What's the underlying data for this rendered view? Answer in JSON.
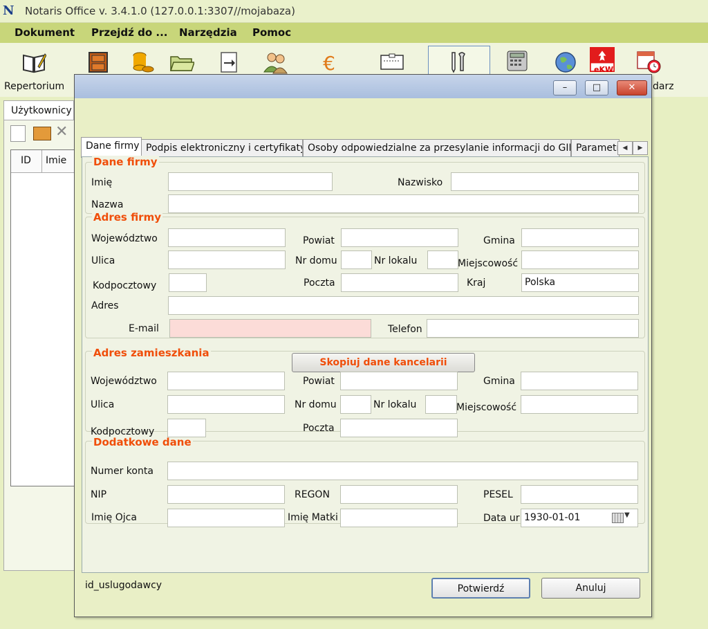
{
  "window": {
    "title": "Notaris Office v. 3.4.1.0 (127.0.0.1:3307//mojabaza)",
    "logo_letter": "N"
  },
  "menu": [
    "Dokument",
    "Przejdź do ...",
    "Narzędzia",
    "Pomoc"
  ],
  "toolbar": {
    "labels": {
      "first": "Repertorium",
      "last": "darz"
    },
    "icons": [
      "book-pen-icon",
      "drawer-icon",
      "coins-icon",
      "folder-icon",
      "document-arrow-icon",
      "people-icon",
      "euro-icon",
      "scanner-icon",
      "tools-icon",
      "calculator-icon",
      "globe-icon",
      "ekw-eagle-icon",
      "calendar-clock-icon"
    ],
    "ekw_text": "eKW",
    "euro_symbol": "€"
  },
  "background": {
    "tab": "Użytkownicy",
    "columns": [
      "ID",
      "Imie"
    ]
  },
  "dialog": {
    "window_buttons": {
      "minimize": "–",
      "maximize": "□",
      "close": "✕"
    },
    "tabs": [
      "Dane firmy",
      "Podpis elektroniczny i certyfikaty",
      "Osoby odpowiedzialne za przesylanie informacji do GIIF",
      "Parametr"
    ],
    "tab_arrows": [
      "◀",
      "▶"
    ],
    "groups": {
      "dane_firmy": {
        "title": "Dane firmy",
        "imie_label": "Imię",
        "imie_value": "",
        "nazwisko_label": "Nazwisko",
        "nazwisko_value": "",
        "nazwa_label": "Nazwa",
        "nazwa_value": ""
      },
      "adres_firmy": {
        "title": "Adres firmy",
        "wojewodztwo_label": "Województwo",
        "wojewodztwo_value": "",
        "powiat_label": "Powiat",
        "powiat_value": "",
        "gmina_label": "Gmina",
        "gmina_value": "",
        "ulica_label": "Ulica",
        "ulica_value": "",
        "nr_domu_label": "Nr domu",
        "nr_domu_value": "",
        "nr_lokalu_label": "Nr lokalu",
        "nr_lokalu_value": "",
        "miejscowosc_label": "Miejscowość",
        "miejscowosc_value": "",
        "kodpocztowy_label": "Kodpocztowy",
        "kodpocztowy_value": "",
        "poczta_label": "Poczta",
        "poczta_value": "",
        "kraj_label": "Kraj",
        "kraj_value": "Polska",
        "adres_label": "Adres",
        "adres_value": "",
        "email_label": "E-mail",
        "email_value": "",
        "telefon_label": "Telefon",
        "telefon_value": ""
      },
      "adres_zamieszkania": {
        "title": "Adres zamieszkania",
        "copy_button": "Skopiuj dane kancelarii",
        "wojewodztwo_label": "Województwo",
        "wojewodztwo_value": "",
        "powiat_label": "Powiat",
        "powiat_value": "",
        "gmina_label": "Gmina",
        "gmina_value": "",
        "ulica_label": "Ulica",
        "ulica_value": "",
        "nr_domu_label": "Nr domu",
        "nr_domu_value": "",
        "nr_lokalu_label": "Nr lokalu",
        "nr_lokalu_value": "",
        "miejscowosc_label": "Miejscowość",
        "miejscowosc_value": "",
        "kodpocztowy_label": "Kodpocztowy",
        "kodpocztowy_value": "",
        "poczta_label": "Poczta",
        "poczta_value": ""
      },
      "dodatkowe_dane": {
        "title": "Dodatkowe dane",
        "numer_konta_label": "Numer konta",
        "numer_konta_value": "",
        "nip_label": "NIP",
        "nip_value": "",
        "regon_label": "REGON",
        "regon_value": "",
        "pesel_label": "PESEL",
        "pesel_value": "",
        "imie_ojca_label": "Imię Ojca",
        "imie_ojca_value": "",
        "imie_matki_label": "Imię Matki",
        "imie_matki_value": "",
        "data_ur_label": "Data ur",
        "data_ur_value": "1930-01-01"
      }
    },
    "footer_label": "id_uslugodawcy",
    "confirm_button": "Potwierdź",
    "cancel_button": "Anuluj"
  },
  "colors": {
    "menubar": "#c8d67a",
    "background": "#e7efc2",
    "group_title": "#f04e0a",
    "email_invalid": "#fcdcd8"
  }
}
